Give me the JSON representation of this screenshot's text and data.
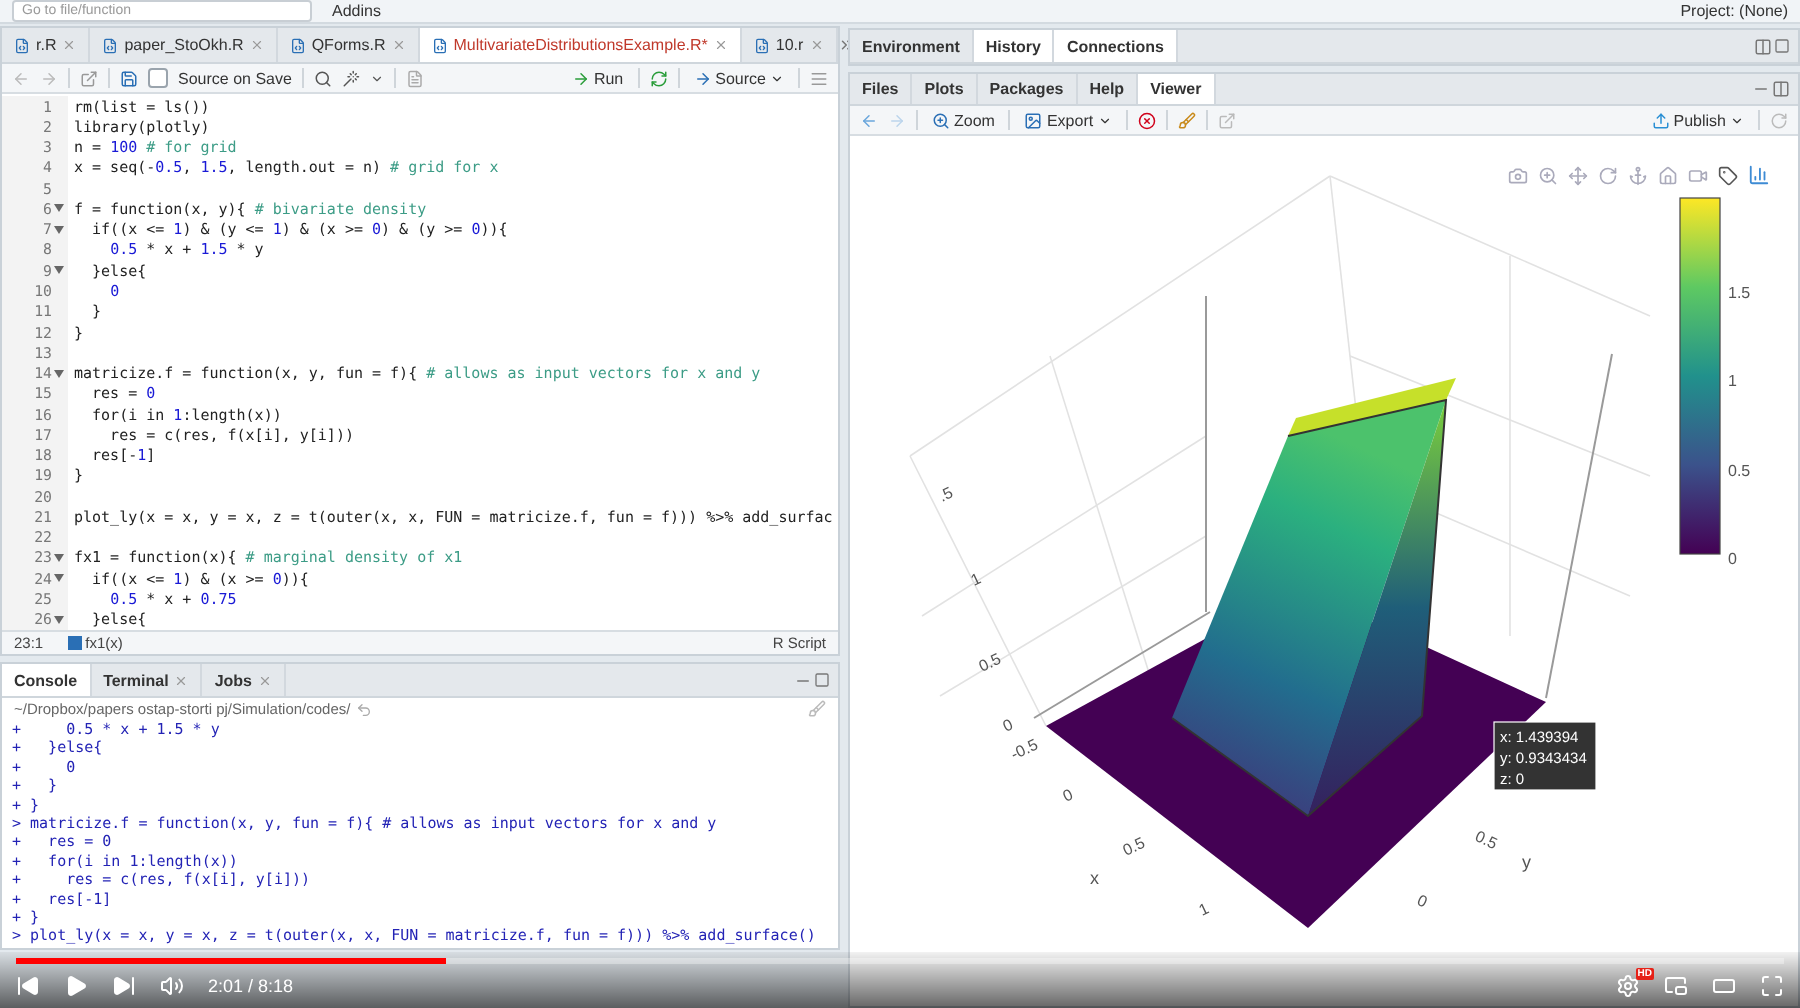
{
  "top_toolbar": {
    "goto_placeholder": "Go to file/function",
    "addins": "Addins",
    "project": "Project: (None)"
  },
  "editor": {
    "tabs": [
      {
        "label": "r.R",
        "selected": false,
        "modified": false
      },
      {
        "label": "paper_StoOkh.R",
        "selected": false,
        "modified": false
      },
      {
        "label": "QForms.R",
        "selected": false,
        "modified": false
      },
      {
        "label": "MultivariateDistributionsExample.R*",
        "selected": true,
        "modified": true
      },
      {
        "label": "10.r",
        "selected": false,
        "modified": false
      }
    ],
    "toolbar": {
      "source_on_save": {
        "label": "Source on Save",
        "checked": false
      },
      "run": "Run",
      "source": "Source"
    },
    "lines": [
      {
        "number": "1",
        "code": "rm(list = ls())",
        "fold": false
      },
      {
        "number": "2",
        "code": "library(plotly)",
        "fold": false
      },
      {
        "number": "3",
        "code": "n = 100 # for grid",
        "fold": false
      },
      {
        "number": "4",
        "code": "x = seq(-0.5, 1.5, length.out = n) # grid for x",
        "fold": false
      },
      {
        "number": "5",
        "fold": false
      },
      {
        "number": "6",
        "code": "f = function(x, y){ # bivariate density",
        "fold": true
      },
      {
        "number": "7",
        "code": "  if((x <= 1) & (y <= 1) & (x >= 0) & (y >= 0)){",
        "fold": true
      },
      {
        "number": "8",
        "code": "    0.5 * x + 1.5 * y",
        "fold": false
      },
      {
        "number": "9",
        "code": "  }else{",
        "fold": true
      },
      {
        "number": "10",
        "code": "    0",
        "fold": false
      },
      {
        "number": "11",
        "code": "  }",
        "fold": false
      },
      {
        "number": "12",
        "code": "}",
        "fold": false
      },
      {
        "number": "13",
        "fold": false
      },
      {
        "number": "14",
        "code": "matricize.f = function(x, y, fun = f){ # allows as input vectors for x and y",
        "fold": true
      },
      {
        "number": "15",
        "code": "  res = 0",
        "fold": false
      },
      {
        "number": "16",
        "code": "  for(i in 1:length(x))",
        "fold": false
      },
      {
        "number": "17",
        "code": "    res = c(res, f(x[i], y[i]))",
        "fold": false
      },
      {
        "number": "18",
        "code": "  res[-1]",
        "fold": false
      },
      {
        "number": "19",
        "code": "}",
        "fold": false
      },
      {
        "number": "20",
        "fold": false
      },
      {
        "number": "21",
        "code": "plot_ly(x = x, y = x, z = t(outer(x, x, FUN = matricize.f, fun = f))) %>% add_surfac",
        "fold": false
      },
      {
        "number": "22",
        "fold": false
      },
      {
        "number": "23",
        "code": "fx1 = function(x){ # marginal density of x1",
        "fold": true
      },
      {
        "number": "24",
        "code": "  if((x <= 1) & (x >= 0)){",
        "fold": true
      },
      {
        "number": "25",
        "code": "    0.5 * x + 0.75",
        "fold": false
      },
      {
        "number": "26",
        "code": "  }else{",
        "fold": true
      }
    ],
    "status": {
      "position": "23:1",
      "scope": "fx1(x)",
      "file_type": "R Script"
    }
  },
  "console": {
    "tabs": [
      {
        "label": "Console",
        "selected": true,
        "closable": false
      },
      {
        "label": "Terminal",
        "selected": false,
        "closable": true
      },
      {
        "label": "Jobs",
        "selected": false,
        "closable": true
      }
    ],
    "path": "~/Dropbox/papers ostap-storti pj/Simulation/codes/",
    "lines": [
      "+     0.5 * x + 1.5 * y",
      "+   }else{",
      "+     0",
      "+   }",
      "+ }",
      "> matricize.f = function(x, y, fun = f){ # allows as input vectors for x and y",
      "+   res = 0",
      "+   for(i in 1:length(x))",
      "+     res = c(res, f(x[i], y[i]))",
      "+   res[-1]",
      "+ }",
      "> plot_ly(x = x, y = x, z = t(outer(x, x, FUN = matricize.f, fun = f))) %>% add_surface()"
    ]
  },
  "environment_pane": {
    "tabs": [
      {
        "label": "Environment",
        "selected": true
      },
      {
        "label": "History",
        "selected": false
      },
      {
        "label": "Connections",
        "selected": false
      }
    ]
  },
  "viewer_pane": {
    "tabs": [
      {
        "label": "Files",
        "selected": false
      },
      {
        "label": "Plots",
        "selected": false
      },
      {
        "label": "Packages",
        "selected": false
      },
      {
        "label": "Help",
        "selected": false
      },
      {
        "label": "Viewer",
        "selected": true
      }
    ],
    "toolbar": {
      "zoom": "Zoom",
      "export": "Export",
      "publish": "Publish"
    },
    "plot": {
      "z_ticks": [
        ".5",
        "1",
        "0.5",
        "0"
      ],
      "x_ticks": [
        "-0.5",
        "0",
        "0.5",
        "1"
      ],
      "x_label": "x",
      "y_ticks": [
        "0.5",
        "0"
      ],
      "y_label": "y",
      "colorbar_ticks": [
        "1.5",
        "1",
        "0.5",
        "0"
      ],
      "tooltip": [
        "x: 1.439394",
        "y: 0.9343434",
        "z: 0"
      ]
    }
  },
  "player": {
    "level": 0.243,
    "time": "2:01 / 8:18",
    "hd_badge": "HD"
  }
}
